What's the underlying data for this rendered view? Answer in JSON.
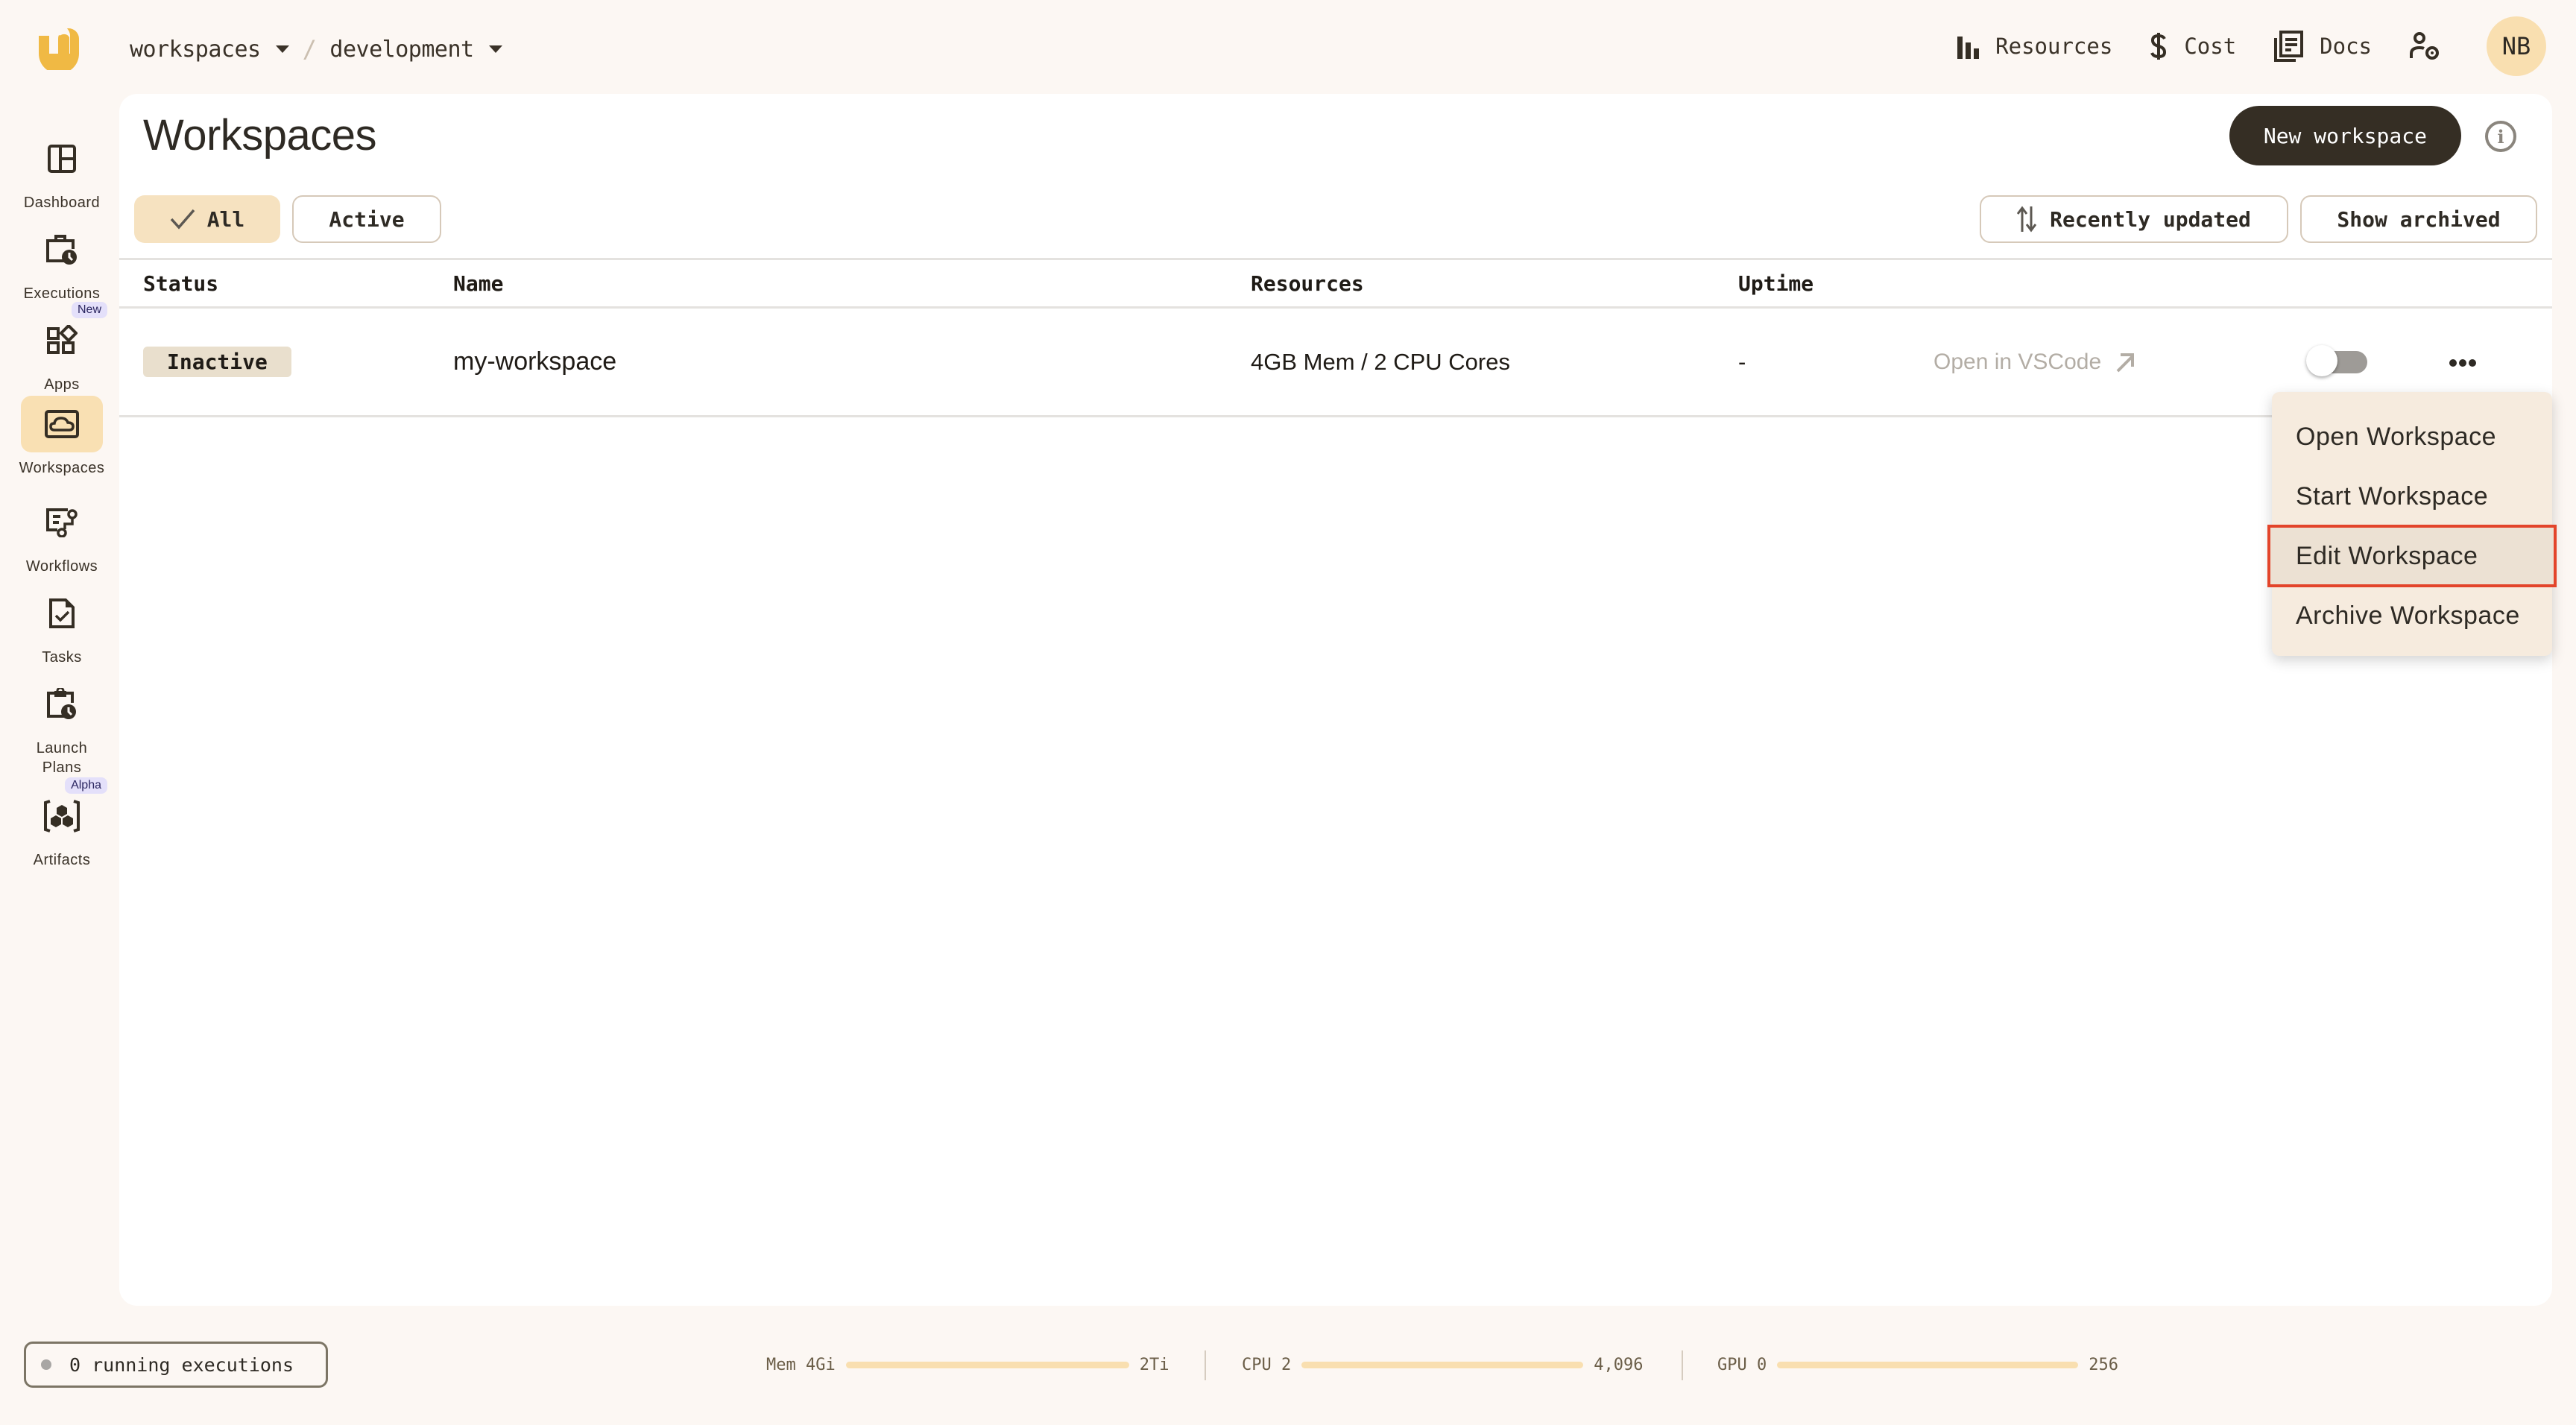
{
  "topbar": {
    "breadcrumb": [
      {
        "label": "workspaces"
      },
      {
        "label": "development"
      }
    ],
    "separator": "/",
    "nav": [
      {
        "label": "Resources",
        "icon": "bar-chart-icon"
      },
      {
        "label": "Cost",
        "icon": "dollar-icon"
      },
      {
        "label": "Docs",
        "icon": "docs-icon"
      }
    ],
    "avatar_initials": "NB"
  },
  "sidebar": {
    "items": [
      {
        "label": "Dashboard",
        "icon": "dashboard-icon",
        "active": false
      },
      {
        "label": "Executions",
        "icon": "executions-icon",
        "active": false
      },
      {
        "label": "Apps",
        "icon": "apps-icon",
        "active": false,
        "badge": "New"
      },
      {
        "label": "Workspaces",
        "icon": "workspaces-icon",
        "active": true
      },
      {
        "label": "Workflows",
        "icon": "workflows-icon",
        "active": false
      },
      {
        "label": "Tasks",
        "icon": "tasks-icon",
        "active": false
      },
      {
        "label": "Launch Plans",
        "icon": "launch-plans-icon",
        "active": false
      },
      {
        "label": "Artifacts",
        "icon": "artifacts-icon",
        "active": false,
        "badge": "Alpha"
      }
    ]
  },
  "main": {
    "title": "Workspaces",
    "new_button": "New workspace",
    "filters": [
      {
        "label": "All",
        "selected": true
      },
      {
        "label": "Active",
        "selected": false
      }
    ],
    "sort_label": "Recently updated",
    "show_archived_label": "Show archived",
    "table": {
      "columns": [
        "Status",
        "Name",
        "Resources",
        "Uptime"
      ],
      "rows": [
        {
          "status": "Inactive",
          "name": "my-workspace",
          "resources": "4GB Mem / 2 CPU Cores",
          "uptime": "-",
          "link": "Open in VSCode",
          "toggle_on": false
        }
      ]
    },
    "menu": {
      "items": [
        "Open Workspace",
        "Start Workspace",
        "Edit Workspace",
        "Archive Workspace"
      ],
      "highlighted": "Edit Workspace"
    }
  },
  "footer": {
    "running_executions": "0 running executions",
    "usage": [
      {
        "label": "Mem 4Gi",
        "max": "2Ti",
        "fraction": 0.002
      },
      {
        "label": "CPU 2",
        "max": "4,096",
        "fraction": 0.0005
      },
      {
        "label": "GPU 0",
        "max": "256",
        "fraction": 0
      }
    ]
  },
  "colors": {
    "background": "#fcf7f3",
    "accent": "#f0b944",
    "active_nav": "#f9e0b3",
    "primary_button": "#352e24",
    "highlight_outline": "#e3442a"
  }
}
